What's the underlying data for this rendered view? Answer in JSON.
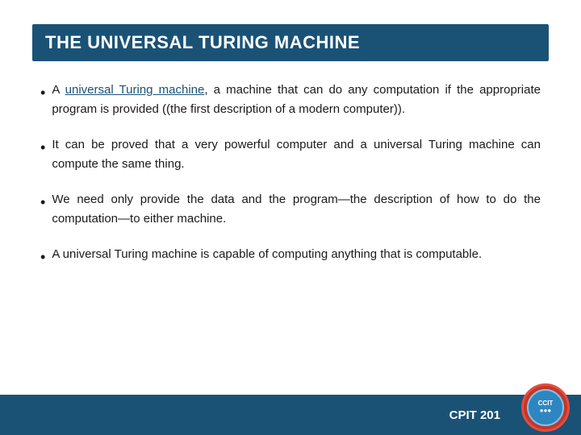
{
  "slide": {
    "title": "THE UNIVERSAL TURING MACHINE",
    "bullets": [
      {
        "id": 1,
        "text_before_underline": "A ",
        "underline_text": "universal Turing machine",
        "text_after": ", a machine that can do any computation if the appropriate program is provided ((the first description of a modern computer))."
      },
      {
        "id": 2,
        "text": "It can be proved that a very powerful computer and a universal Turing machine can compute the same thing."
      },
      {
        "id": 3,
        "text": "We need only provide the data and the program—the description of how to do the computation—to either machine."
      },
      {
        "id": 4,
        "text_before": "A universal Turing machine is capable ",
        "text_of": "of",
        "text_after": " computing anything that is computable."
      }
    ],
    "footer": {
      "label": "CPIT 201",
      "logo_line1": "CCIT",
      "logo_line2": "www"
    }
  }
}
